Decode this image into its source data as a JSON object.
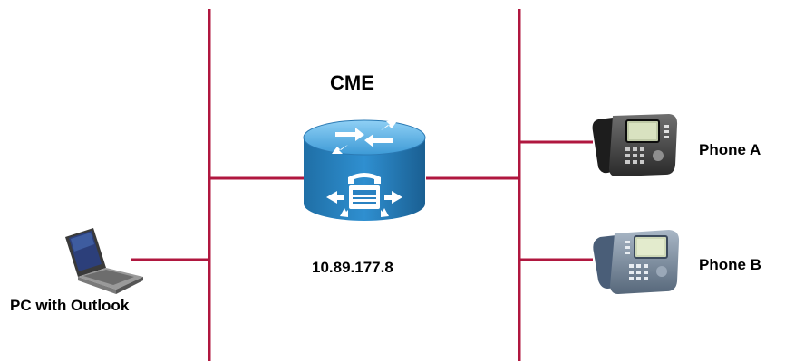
{
  "labels": {
    "router": "CME",
    "router_ip": "10.89.177.8",
    "pc": "PC with Outlook",
    "phone_a": "Phone A",
    "phone_b": "Phone B"
  },
  "icons": {
    "router": "cme-router-icon",
    "pc": "laptop-icon",
    "phone_a": "ip-phone-icon",
    "phone_b": "ip-phone-icon"
  },
  "colors": {
    "link": "#b0173f",
    "router_top": "#56a6d9",
    "router_body": "#1a6ea8",
    "background": "#ffffff"
  }
}
